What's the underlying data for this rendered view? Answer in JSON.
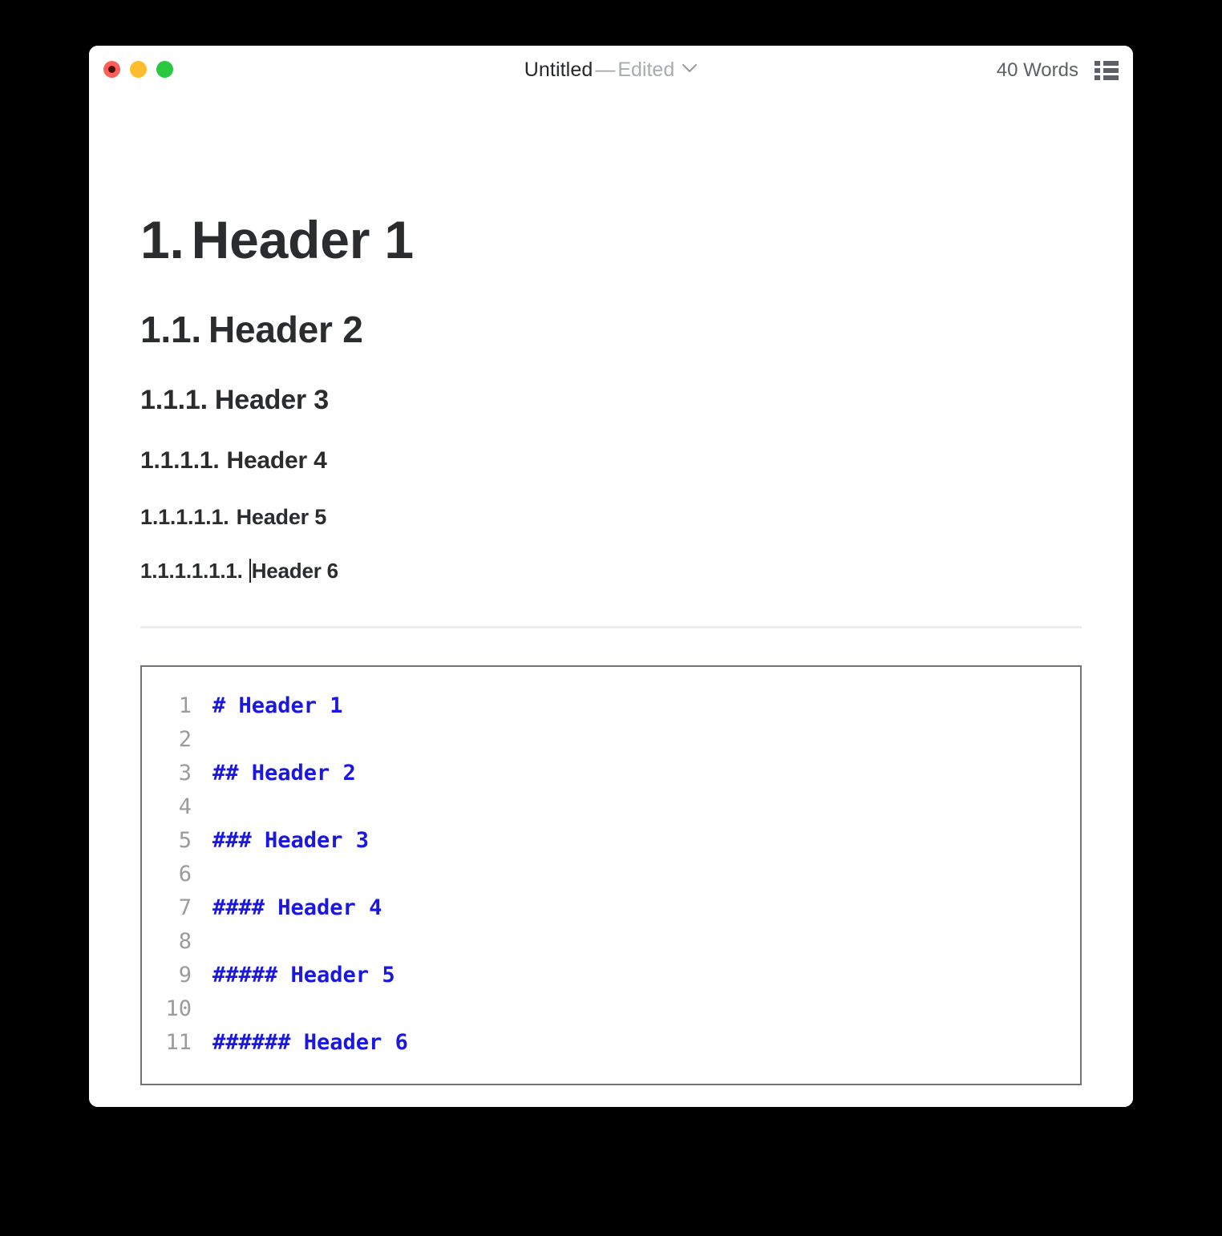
{
  "window": {
    "titlebar": {
      "traffic_lights": [
        {
          "name": "close",
          "color": "#ff5f57"
        },
        {
          "name": "minimize",
          "color": "#febc2e"
        },
        {
          "name": "maximize",
          "color": "#28c840"
        }
      ],
      "document_title": "Untitled",
      "separator": "—",
      "edited_state": "Edited",
      "chevron_icon": "chevron-down-icon",
      "word_count": "40 Words",
      "list_icon": "bulleted-list-icon"
    }
  },
  "document": {
    "headings": [
      {
        "number": "1.",
        "text": "Header 1",
        "level": 1
      },
      {
        "number": "1.1.",
        "text": "Header 2",
        "level": 2
      },
      {
        "number": "1.1.1.",
        "text": "Header 3",
        "level": 3
      },
      {
        "number": "1.1.1.1.",
        "text": "Header 4",
        "level": 4
      },
      {
        "number": "1.1.1.1.1.",
        "text": "Header 5",
        "level": 5
      },
      {
        "number": "1.1.1.1.1.1.",
        "text": "Header 6",
        "level": 6
      }
    ],
    "caret_before": "Header 6",
    "code_block": {
      "language": "markdown",
      "lines": [
        {
          "number": "1",
          "text": "# Header 1"
        },
        {
          "number": "2",
          "text": ""
        },
        {
          "number": "3",
          "text": "## Header 2"
        },
        {
          "number": "4",
          "text": ""
        },
        {
          "number": "5",
          "text": "### Header 3"
        },
        {
          "number": "6",
          "text": ""
        },
        {
          "number": "7",
          "text": "#### Header 4"
        },
        {
          "number": "8",
          "text": ""
        },
        {
          "number": "9",
          "text": "##### Header 5"
        },
        {
          "number": "10",
          "text": ""
        },
        {
          "number": "11",
          "text": "###### Header 6"
        }
      ]
    }
  },
  "colors": {
    "code_text": "#1a17e0",
    "line_number": "#9b9b9b",
    "heading": "#2a2c2e",
    "code_border": "#6f7277",
    "rule": "#ececec",
    "desktop": "#000000"
  }
}
